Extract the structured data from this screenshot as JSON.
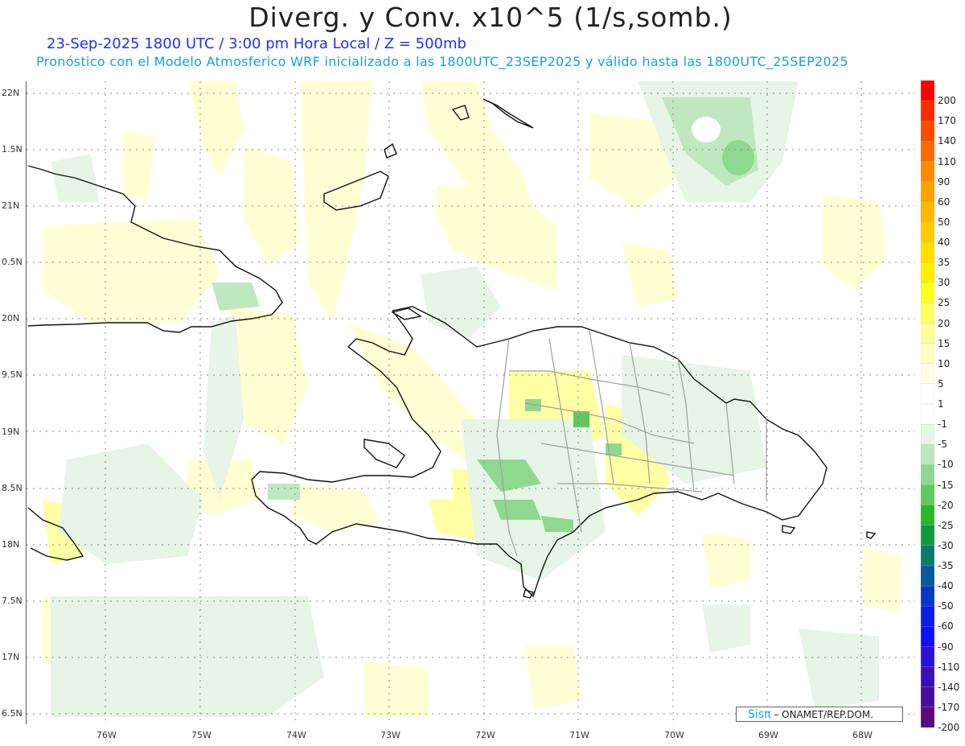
{
  "header": {
    "title": "Diverg. y Conv. x10^5 (1/s,somb.)",
    "subtitle_date": "23-Sep-2025  1800 UTC / 3:00 pm Hora Local / Z = 500mb",
    "subtitle_model": "Pronóstico con el Modelo Atmosferico WRF inicializado a las 1800UTC_23SEP2025 y válido hasta las  1800UTC_25SEP2025"
  },
  "axes": {
    "lat_labels": [
      "22N",
      "1.5N",
      "21N",
      "0.5N",
      "20N",
      "9.5N",
      "19N",
      "8.5N",
      "18N",
      "7.5N",
      "17N",
      "6.5N"
    ],
    "lon_labels": [
      "76W",
      "75W",
      "74W",
      "73W",
      "72W",
      "71W",
      "70W",
      "69W",
      "68W"
    ]
  },
  "colorbar": {
    "labels": [
      "200",
      "170",
      "140",
      "110",
      "90",
      "60",
      "50",
      "40",
      "35",
      "30",
      "25",
      "20",
      "15",
      "10",
      "5",
      "1",
      "-1",
      "-5",
      "-10",
      "-15",
      "-20",
      "-25",
      "-30",
      "-35",
      "-40",
      "-50",
      "-60",
      "-90",
      "-110",
      "-140",
      "-170",
      "-200"
    ],
    "colors": [
      "#ff0000",
      "#ff2a00",
      "#ff4a00",
      "#ff6a00",
      "#ff8a00",
      "#ffa200",
      "#ffb800",
      "#ffcc00",
      "#ffde00",
      "#ffee00",
      "#ffff20",
      "#ffff60",
      "#ffff9a",
      "#ffffc4",
      "#ffffe8",
      "#ffffff",
      "#ffffff",
      "#e6f5e6",
      "#bfe8bf",
      "#8fd88f",
      "#5fc85f",
      "#2fb42f",
      "#119a3c",
      "#0e7a6a",
      "#0a5a9a",
      "#0838c8",
      "#0a1ee6",
      "#1010ff",
      "#2a10d8",
      "#3a10b8",
      "#4a0c9a",
      "#5a0880"
    ]
  },
  "credit": {
    "sis": "Sisπ",
    "org": "– ONAMET/REP.DOM."
  }
}
